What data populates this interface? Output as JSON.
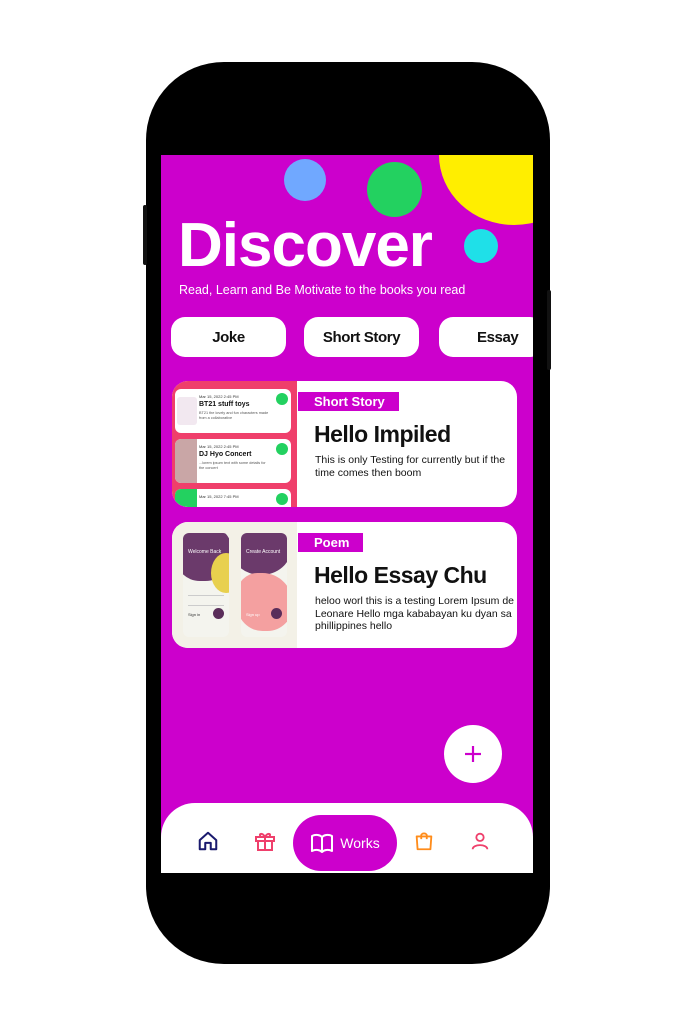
{
  "header": {
    "title": "Discover",
    "subtitle": "Read, Learn and Be Motivate to the books you read"
  },
  "categories": [
    "Joke",
    "Short Story",
    "Essay"
  ],
  "cards": [
    {
      "tag": "Short Story",
      "title": "Hello Impiled",
      "description": "This is only Testing for currently but if the time comes then boom",
      "thumbnail": {
        "items": [
          {
            "meta": "Mar 15, 2022 2:45 PM",
            "title": "BT21 stuff toys",
            "desc": "BT21 the lovely and fun characters made from a collaborative"
          },
          {
            "meta": "Mar 15, 2022 2:45 PM",
            "title": "DJ Hyo Concert",
            "desc": "...lorem ipsum text with some details for the concert"
          },
          {
            "meta": "Mar 15, 2022 7:45 PM",
            "title": "",
            "desc": ""
          }
        ]
      }
    },
    {
      "tag": "Poem",
      "title": "Hello Essay Chu",
      "description": "heloo worl this is a testing Lorem Ipsum de Leonare Hello mga kababayan ku dyan sa phillippines hello",
      "thumbnail": {
        "screens": [
          {
            "heading": "Welcome Back",
            "action": "Sign in"
          },
          {
            "heading": "Create Account",
            "action": "Sign up"
          }
        ]
      }
    }
  ],
  "fab": {
    "label": "+"
  },
  "bottom_nav": {
    "items": [
      "home-icon",
      "gift-icon",
      "book-icon",
      "shopping-bag-icon",
      "user-icon"
    ],
    "active_label": "Works"
  },
  "colors": {
    "accent": "#cc00cc",
    "deco_blue": "#70a8ff",
    "deco_green": "#23d160",
    "deco_yellow": "#ffee00",
    "deco_cyan": "#1fe0e8"
  }
}
